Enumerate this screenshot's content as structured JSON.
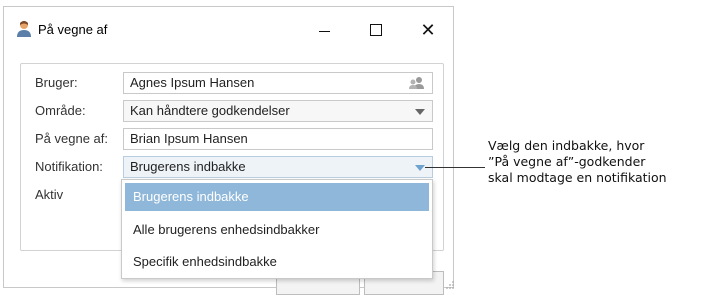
{
  "window": {
    "title": "På vegne af",
    "controls": {
      "minimize": "—",
      "close": "✕"
    }
  },
  "form": {
    "rows": [
      {
        "label": "Bruger:",
        "value": "Agnes Ipsum Hansen",
        "kind": "text-with-user-picker"
      },
      {
        "label": "Område:",
        "value": "Kan håndtere godkendelser",
        "kind": "select"
      },
      {
        "label": "På vegne af:",
        "value": "Brian Ipsum Hansen",
        "kind": "text"
      },
      {
        "label": "Notifikation:",
        "value": "Brugerens indbakke",
        "kind": "select",
        "state": "open"
      },
      {
        "label": "Aktiv"
      }
    ]
  },
  "dropdown": {
    "options": [
      {
        "label": "Brugerens indbakke",
        "selected": true
      },
      {
        "label": "Alle brugerens enhedsindbakker",
        "selected": false
      },
      {
        "label": "Specifik enhedsindbakke",
        "selected": false
      }
    ],
    "selected_color": "#8fb7d9"
  },
  "annotation": {
    "lines": [
      "Vælg den indbakke, hvor",
      "”På vegne af”-godkender",
      "skal modtage en notifikation"
    ]
  },
  "icons": {
    "title": "user-icon",
    "user_picker": "users-icon",
    "select_arrow": "chevron-down-icon"
  }
}
